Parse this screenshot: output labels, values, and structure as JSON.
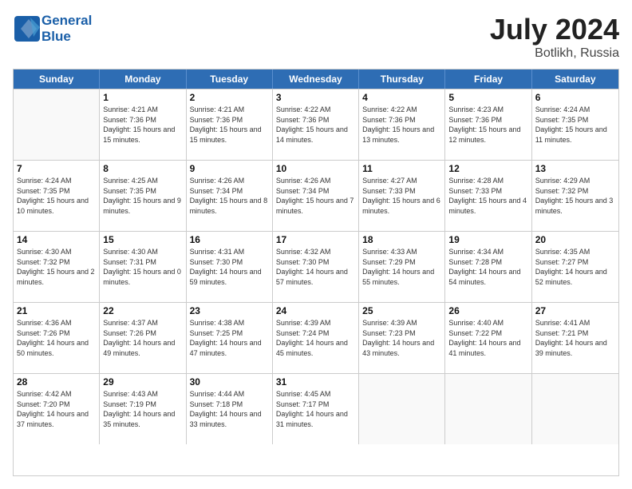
{
  "header": {
    "logo_line1": "General",
    "logo_line2": "Blue",
    "month_year": "July 2024",
    "location": "Botlikh, Russia"
  },
  "weekdays": [
    "Sunday",
    "Monday",
    "Tuesday",
    "Wednesday",
    "Thursday",
    "Friday",
    "Saturday"
  ],
  "weeks": [
    [
      {
        "day": "",
        "sunrise": "",
        "sunset": "",
        "daylight": ""
      },
      {
        "day": "1",
        "sunrise": "Sunrise: 4:21 AM",
        "sunset": "Sunset: 7:36 PM",
        "daylight": "Daylight: 15 hours and 15 minutes."
      },
      {
        "day": "2",
        "sunrise": "Sunrise: 4:21 AM",
        "sunset": "Sunset: 7:36 PM",
        "daylight": "Daylight: 15 hours and 15 minutes."
      },
      {
        "day": "3",
        "sunrise": "Sunrise: 4:22 AM",
        "sunset": "Sunset: 7:36 PM",
        "daylight": "Daylight: 15 hours and 14 minutes."
      },
      {
        "day": "4",
        "sunrise": "Sunrise: 4:22 AM",
        "sunset": "Sunset: 7:36 PM",
        "daylight": "Daylight: 15 hours and 13 minutes."
      },
      {
        "day": "5",
        "sunrise": "Sunrise: 4:23 AM",
        "sunset": "Sunset: 7:36 PM",
        "daylight": "Daylight: 15 hours and 12 minutes."
      },
      {
        "day": "6",
        "sunrise": "Sunrise: 4:24 AM",
        "sunset": "Sunset: 7:35 PM",
        "daylight": "Daylight: 15 hours and 11 minutes."
      }
    ],
    [
      {
        "day": "7",
        "sunrise": "Sunrise: 4:24 AM",
        "sunset": "Sunset: 7:35 PM",
        "daylight": "Daylight: 15 hours and 10 minutes."
      },
      {
        "day": "8",
        "sunrise": "Sunrise: 4:25 AM",
        "sunset": "Sunset: 7:35 PM",
        "daylight": "Daylight: 15 hours and 9 minutes."
      },
      {
        "day": "9",
        "sunrise": "Sunrise: 4:26 AM",
        "sunset": "Sunset: 7:34 PM",
        "daylight": "Daylight: 15 hours and 8 minutes."
      },
      {
        "day": "10",
        "sunrise": "Sunrise: 4:26 AM",
        "sunset": "Sunset: 7:34 PM",
        "daylight": "Daylight: 15 hours and 7 minutes."
      },
      {
        "day": "11",
        "sunrise": "Sunrise: 4:27 AM",
        "sunset": "Sunset: 7:33 PM",
        "daylight": "Daylight: 15 hours and 6 minutes."
      },
      {
        "day": "12",
        "sunrise": "Sunrise: 4:28 AM",
        "sunset": "Sunset: 7:33 PM",
        "daylight": "Daylight: 15 hours and 4 minutes."
      },
      {
        "day": "13",
        "sunrise": "Sunrise: 4:29 AM",
        "sunset": "Sunset: 7:32 PM",
        "daylight": "Daylight: 15 hours and 3 minutes."
      }
    ],
    [
      {
        "day": "14",
        "sunrise": "Sunrise: 4:30 AM",
        "sunset": "Sunset: 7:32 PM",
        "daylight": "Daylight: 15 hours and 2 minutes."
      },
      {
        "day": "15",
        "sunrise": "Sunrise: 4:30 AM",
        "sunset": "Sunset: 7:31 PM",
        "daylight": "Daylight: 15 hours and 0 minutes."
      },
      {
        "day": "16",
        "sunrise": "Sunrise: 4:31 AM",
        "sunset": "Sunset: 7:30 PM",
        "daylight": "Daylight: 14 hours and 59 minutes."
      },
      {
        "day": "17",
        "sunrise": "Sunrise: 4:32 AM",
        "sunset": "Sunset: 7:30 PM",
        "daylight": "Daylight: 14 hours and 57 minutes."
      },
      {
        "day": "18",
        "sunrise": "Sunrise: 4:33 AM",
        "sunset": "Sunset: 7:29 PM",
        "daylight": "Daylight: 14 hours and 55 minutes."
      },
      {
        "day": "19",
        "sunrise": "Sunrise: 4:34 AM",
        "sunset": "Sunset: 7:28 PM",
        "daylight": "Daylight: 14 hours and 54 minutes."
      },
      {
        "day": "20",
        "sunrise": "Sunrise: 4:35 AM",
        "sunset": "Sunset: 7:27 PM",
        "daylight": "Daylight: 14 hours and 52 minutes."
      }
    ],
    [
      {
        "day": "21",
        "sunrise": "Sunrise: 4:36 AM",
        "sunset": "Sunset: 7:26 PM",
        "daylight": "Daylight: 14 hours and 50 minutes."
      },
      {
        "day": "22",
        "sunrise": "Sunrise: 4:37 AM",
        "sunset": "Sunset: 7:26 PM",
        "daylight": "Daylight: 14 hours and 49 minutes."
      },
      {
        "day": "23",
        "sunrise": "Sunrise: 4:38 AM",
        "sunset": "Sunset: 7:25 PM",
        "daylight": "Daylight: 14 hours and 47 minutes."
      },
      {
        "day": "24",
        "sunrise": "Sunrise: 4:39 AM",
        "sunset": "Sunset: 7:24 PM",
        "daylight": "Daylight: 14 hours and 45 minutes."
      },
      {
        "day": "25",
        "sunrise": "Sunrise: 4:39 AM",
        "sunset": "Sunset: 7:23 PM",
        "daylight": "Daylight: 14 hours and 43 minutes."
      },
      {
        "day": "26",
        "sunrise": "Sunrise: 4:40 AM",
        "sunset": "Sunset: 7:22 PM",
        "daylight": "Daylight: 14 hours and 41 minutes."
      },
      {
        "day": "27",
        "sunrise": "Sunrise: 4:41 AM",
        "sunset": "Sunset: 7:21 PM",
        "daylight": "Daylight: 14 hours and 39 minutes."
      }
    ],
    [
      {
        "day": "28",
        "sunrise": "Sunrise: 4:42 AM",
        "sunset": "Sunset: 7:20 PM",
        "daylight": "Daylight: 14 hours and 37 minutes."
      },
      {
        "day": "29",
        "sunrise": "Sunrise: 4:43 AM",
        "sunset": "Sunset: 7:19 PM",
        "daylight": "Daylight: 14 hours and 35 minutes."
      },
      {
        "day": "30",
        "sunrise": "Sunrise: 4:44 AM",
        "sunset": "Sunset: 7:18 PM",
        "daylight": "Daylight: 14 hours and 33 minutes."
      },
      {
        "day": "31",
        "sunrise": "Sunrise: 4:45 AM",
        "sunset": "Sunset: 7:17 PM",
        "daylight": "Daylight: 14 hours and 31 minutes."
      },
      {
        "day": "",
        "sunrise": "",
        "sunset": "",
        "daylight": ""
      },
      {
        "day": "",
        "sunrise": "",
        "sunset": "",
        "daylight": ""
      },
      {
        "day": "",
        "sunrise": "",
        "sunset": "",
        "daylight": ""
      }
    ]
  ]
}
